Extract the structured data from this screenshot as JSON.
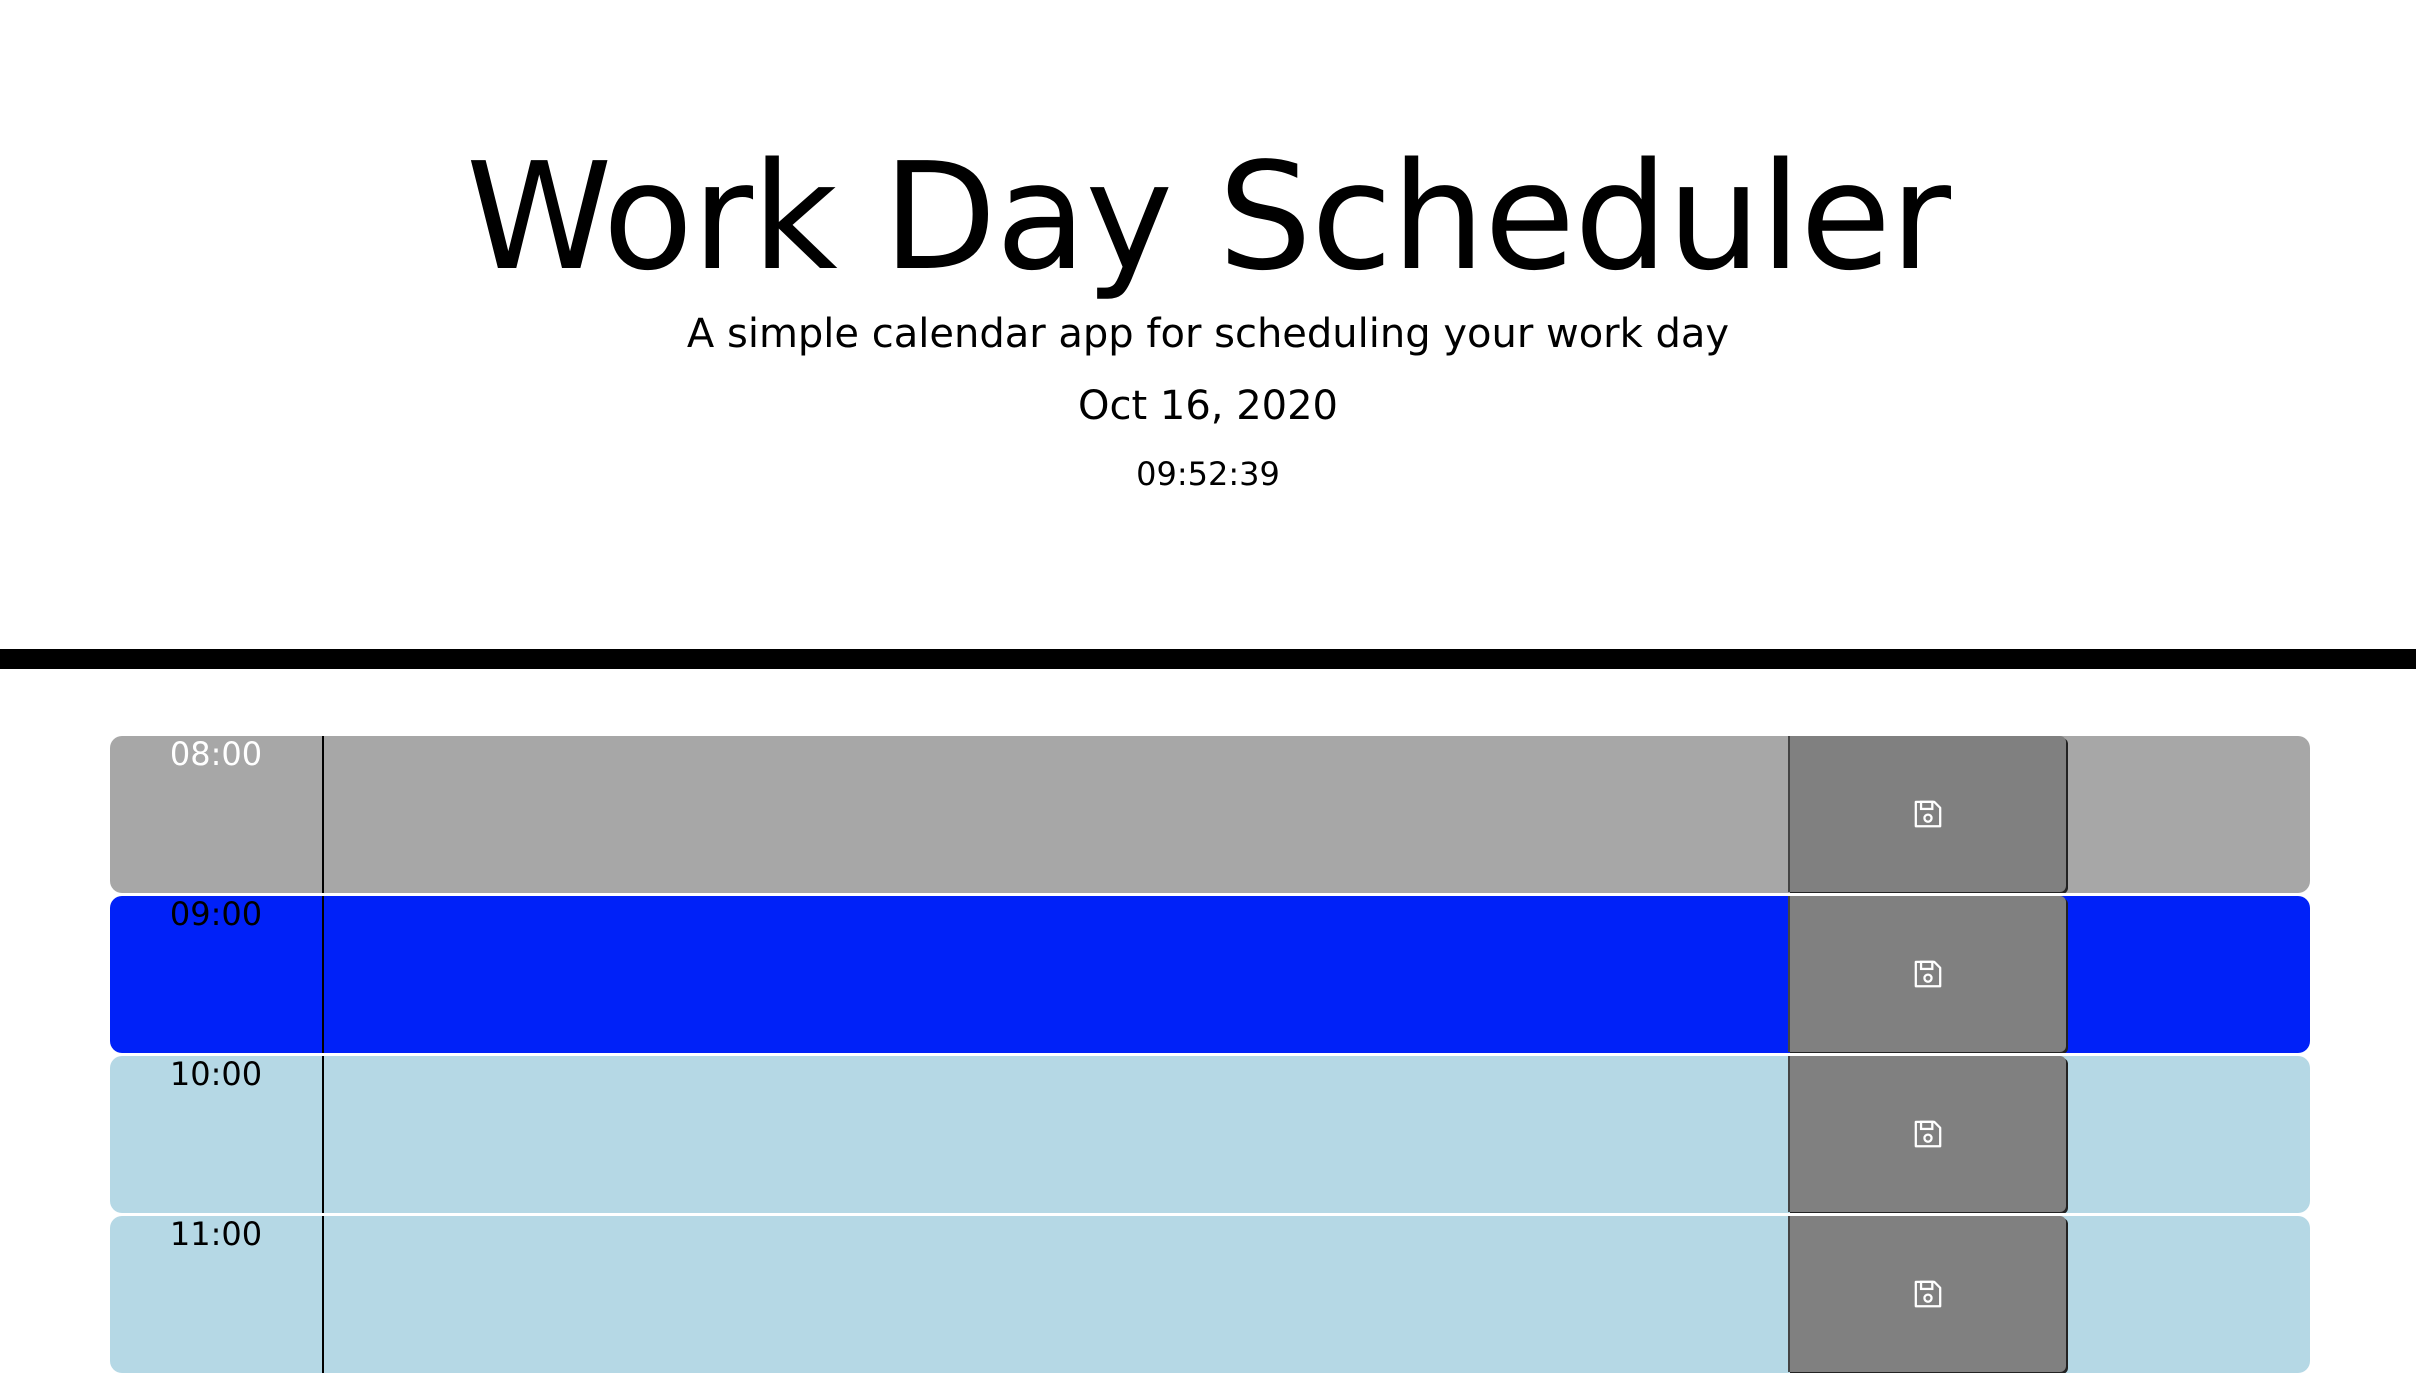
{
  "header": {
    "title": "Work Day Scheduler",
    "lead": "A simple calendar app for scheduling your work day",
    "date": "Oct 16, 2020",
    "clock": "09:52:39"
  },
  "colors": {
    "past": "#a7a7a7",
    "present": "#0021f8",
    "future": "#b5d8e5",
    "save_button": "#808080"
  },
  "time_blocks": [
    {
      "hour": "08:00",
      "state": "past",
      "description": "",
      "save_icon": "save-icon"
    },
    {
      "hour": "09:00",
      "state": "present",
      "description": "",
      "save_icon": "save-icon"
    },
    {
      "hour": "10:00",
      "state": "future",
      "description": "",
      "save_icon": "save-icon"
    },
    {
      "hour": "11:00",
      "state": "future",
      "description": "",
      "save_icon": "save-icon"
    }
  ]
}
